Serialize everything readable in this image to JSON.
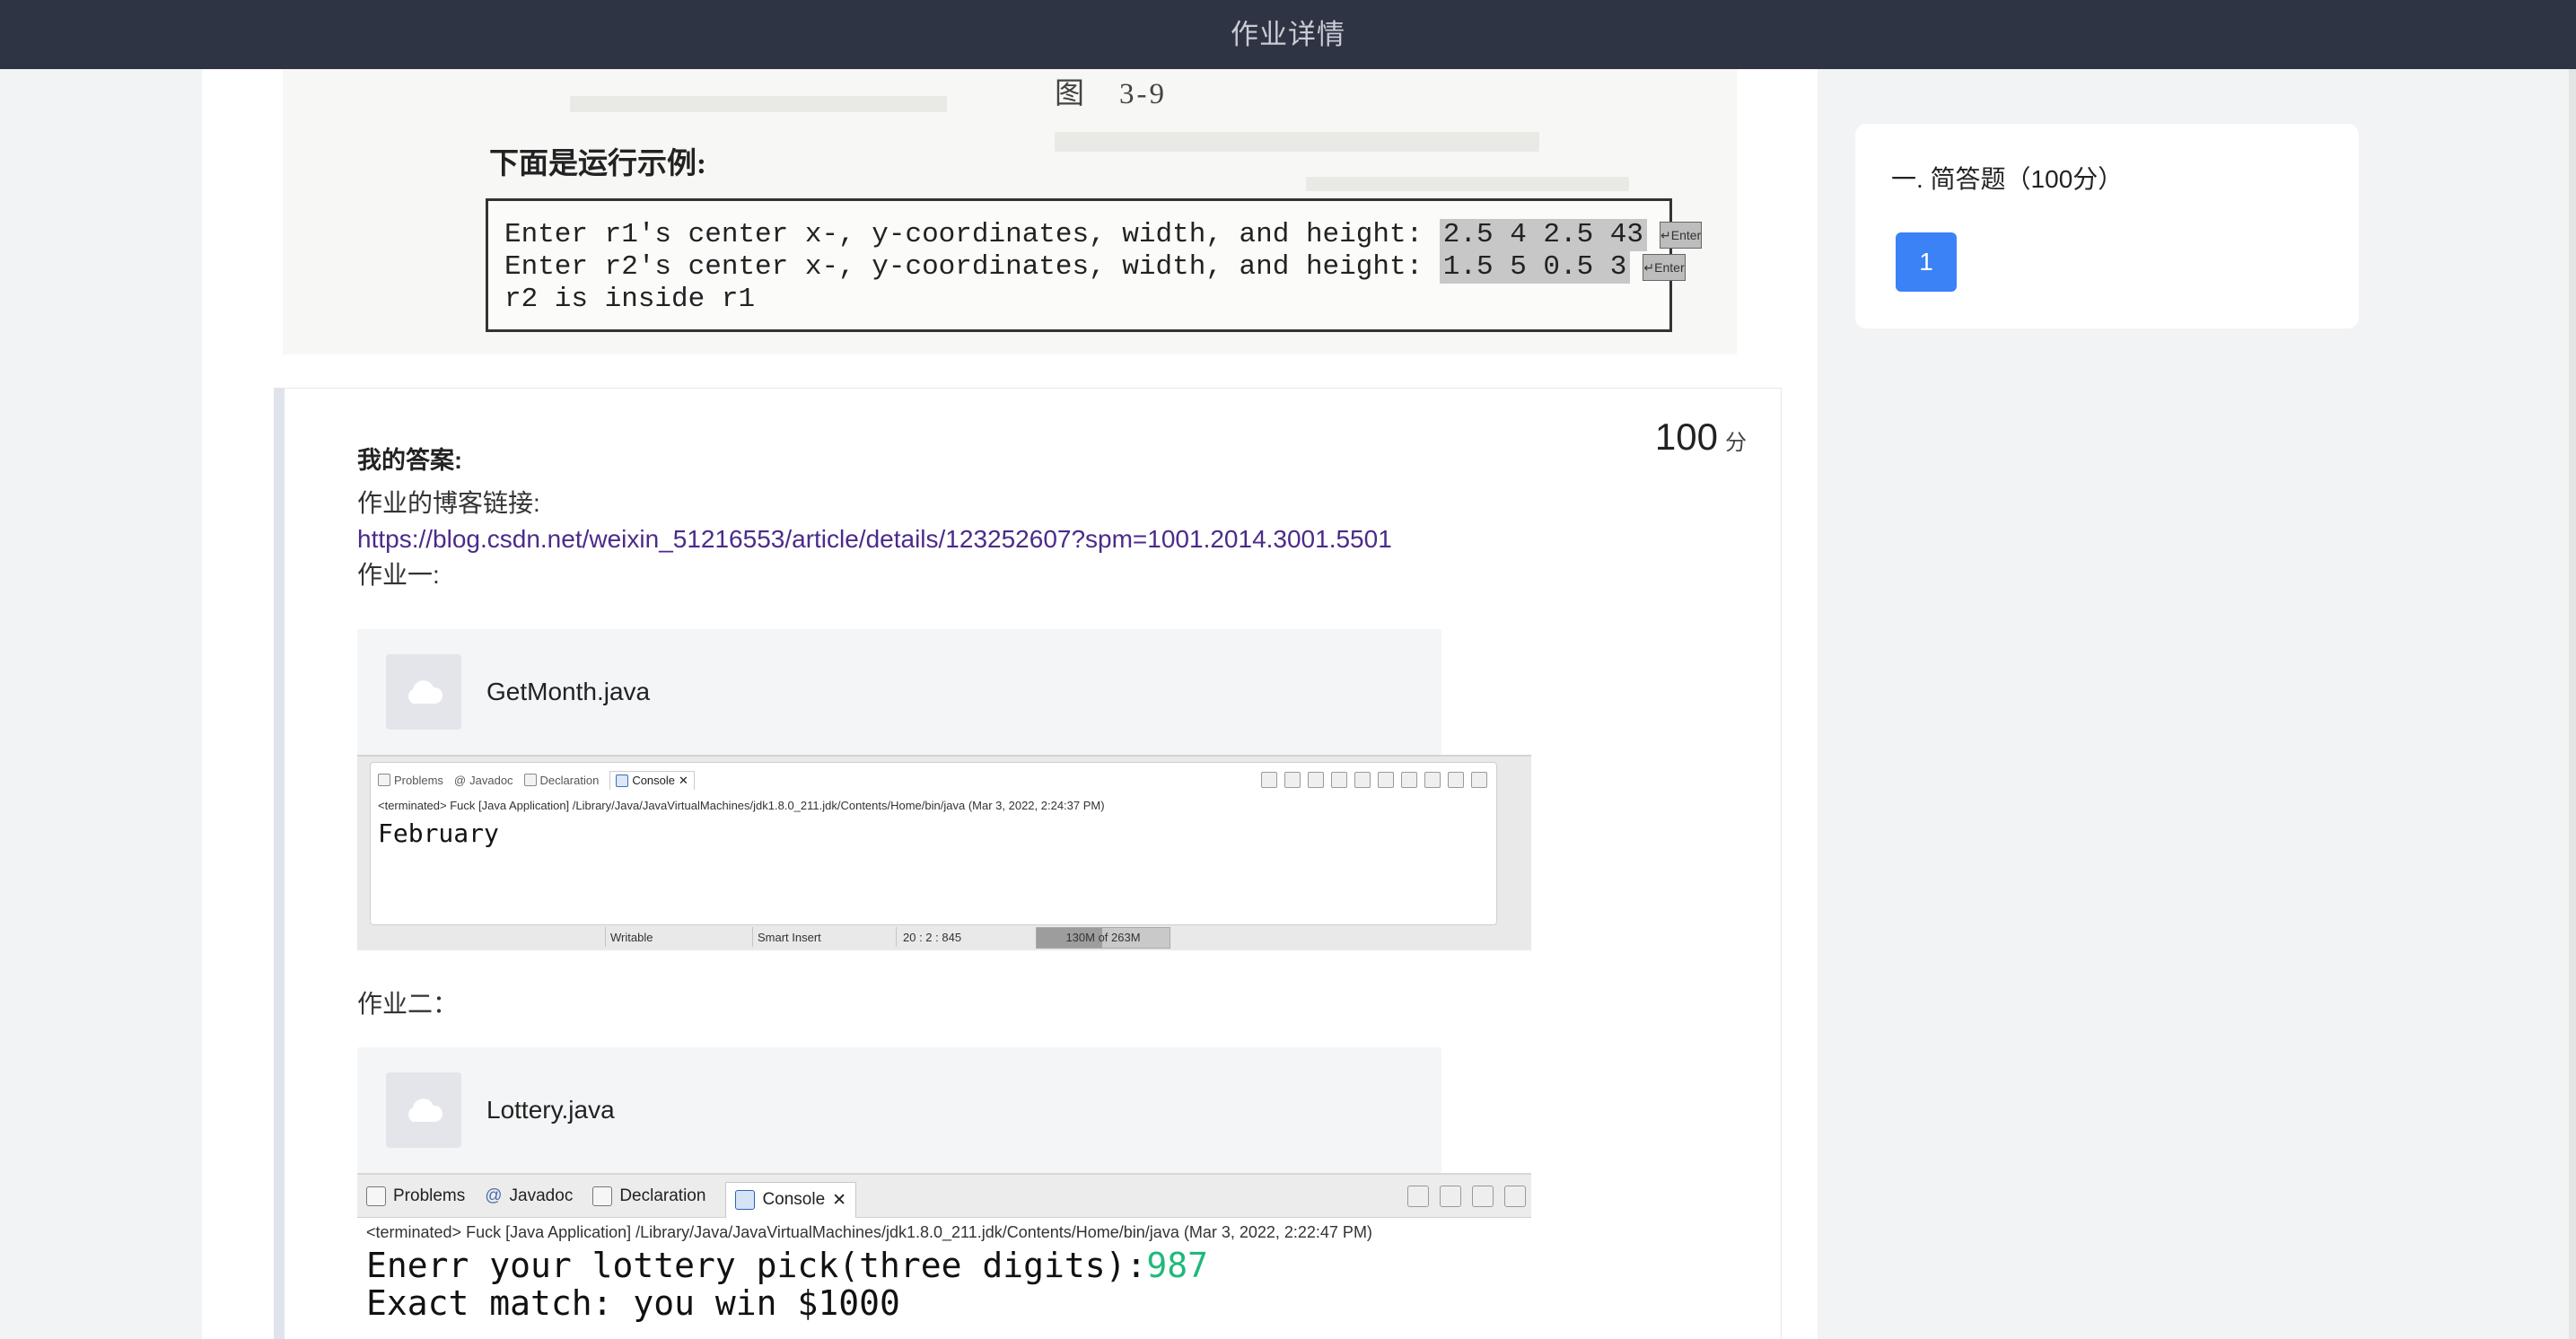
{
  "header": {
    "title": "作业详情"
  },
  "scan": {
    "figure_caption": "图　3-9",
    "example_title": "下面是运行示例:",
    "lines": [
      {
        "prompt": "Enter r1's center x-, y-coordinates, width, and height: ",
        "input": "2.5 4 2.5 43",
        "key": "↵Enter"
      },
      {
        "prompt": "Enter r2's center x-, y-coordinates, width, and height: ",
        "input": "1.5 5 0.5 3",
        "key": "↵Enter"
      },
      {
        "prompt": "r2 is inside r1",
        "input": "",
        "key": ""
      }
    ]
  },
  "answer": {
    "score": "100",
    "score_unit": "分",
    "label": "我的答案:",
    "blog_label": "作业的博客链接:",
    "blog_link": "https://blog.csdn.net/weixin_51216553/article/details/123252607?spm=1001.2014.3001.5501",
    "hw1_label": "作业一:",
    "hw1_file": "GetMonth.java",
    "hw2_label": "作业二：",
    "hw2_file": "Lottery.java"
  },
  "console1": {
    "tabs": [
      "Problems",
      "Javadoc",
      "Declaration",
      "Console"
    ],
    "terminated": "<terminated> Fuck [Java Application] /Library/Java/JavaVirtualMachines/jdk1.8.0_211.jdk/Contents/Home/bin/java (Mar 3, 2022, 2:24:37 PM)",
    "output": "February",
    "status": {
      "writable": "Writable",
      "insert": "Smart Insert",
      "position": "20 : 2 : 845",
      "memory": "130M of 263M",
      "memory_fraction": 0.49
    }
  },
  "console2": {
    "tabs": [
      "Problems",
      "Javadoc",
      "Declaration",
      "Console"
    ],
    "terminated": "<terminated> Fuck [Java Application] /Library/Java/JavaVirtualMachines/jdk1.8.0_211.jdk/Contents/Home/bin/java (Mar 3, 2022, 2:22:47 PM)",
    "line1_prompt": "Enerr your lottery pick(three digits):",
    "line1_input": "987",
    "line2": "Exact match: you win $1000"
  },
  "side": {
    "section_title": "一. 简答题（100分）",
    "question_numbers": [
      "1"
    ],
    "accent": "#3b82f6"
  }
}
